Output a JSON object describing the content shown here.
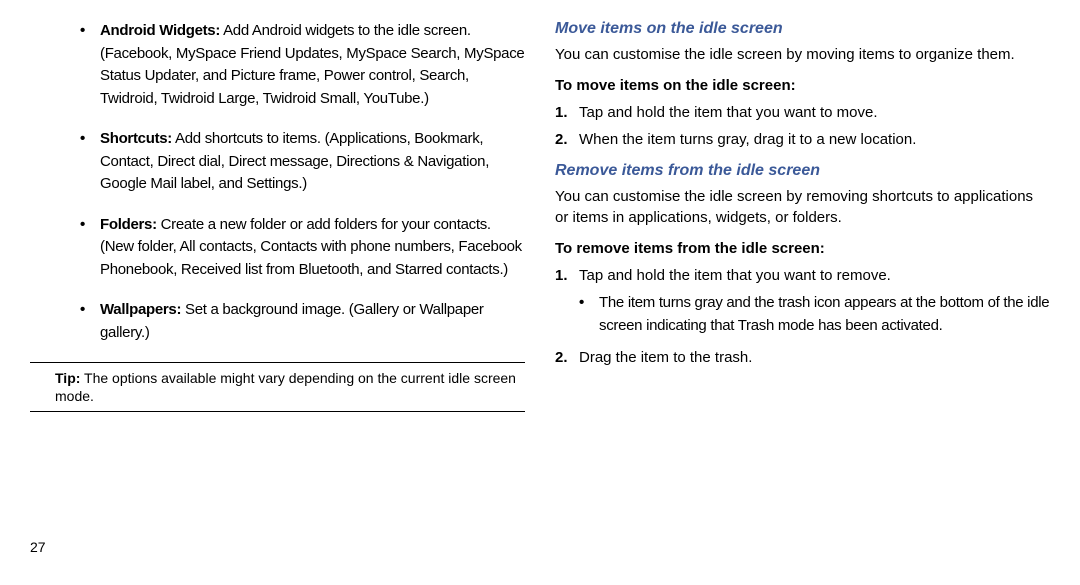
{
  "left": {
    "bullets": [
      {
        "label": "Android Widgets:",
        "text": " Add Android widgets to the idle screen. (Facebook, MySpace Friend Updates, MySpace Search, MySpace Status Updater, and Picture frame, Power control, Search, Twidroid, Twidroid Large, Twidroid Small, YouTube.)"
      },
      {
        "label": "Shortcuts:",
        "text": " Add shortcuts to items. (Applications, Bookmark, Contact, Direct dial, Direct message, Directions & Navigation, Google Mail label, and Settings.)"
      },
      {
        "label": "Folders:",
        "text": " Create a new folder or add folders for your contacts. (New folder, All contacts, Contacts with phone numbers, Facebook Phonebook, Received list from Bluetooth, and Starred contacts.)"
      },
      {
        "label": "Wallpapers:",
        "text": " Set a background image. (Gallery or Wallpaper gallery.)"
      }
    ],
    "tip": {
      "label": "Tip:",
      "text": " The options available might vary depending on the current idle screen mode."
    }
  },
  "right": {
    "move": {
      "heading": "Move items on the idle screen",
      "body": "You can customise the idle screen by moving items to organize them.",
      "subheading": "To move items on the idle screen:",
      "steps": [
        {
          "num": "1.",
          "text": "Tap and hold the item that you want to move."
        },
        {
          "num": "2.",
          "text": "When the item turns gray, drag it to a new location."
        }
      ]
    },
    "remove": {
      "heading": "Remove items from the idle screen",
      "body": "You can customise the idle screen by removing shortcuts to applications or items in applications, widgets, or folders.",
      "subheading": "To remove items from the idle screen:",
      "step1": {
        "num": "1.",
        "text": "Tap and hold the item that you want to remove."
      },
      "subbullet": "The item turns gray and the trash icon appears at the bottom of the idle screen indicating that Trash mode has been activated.",
      "step2": {
        "num": "2.",
        "text": "Drag the item to the trash."
      }
    }
  },
  "pageNumber": "27"
}
